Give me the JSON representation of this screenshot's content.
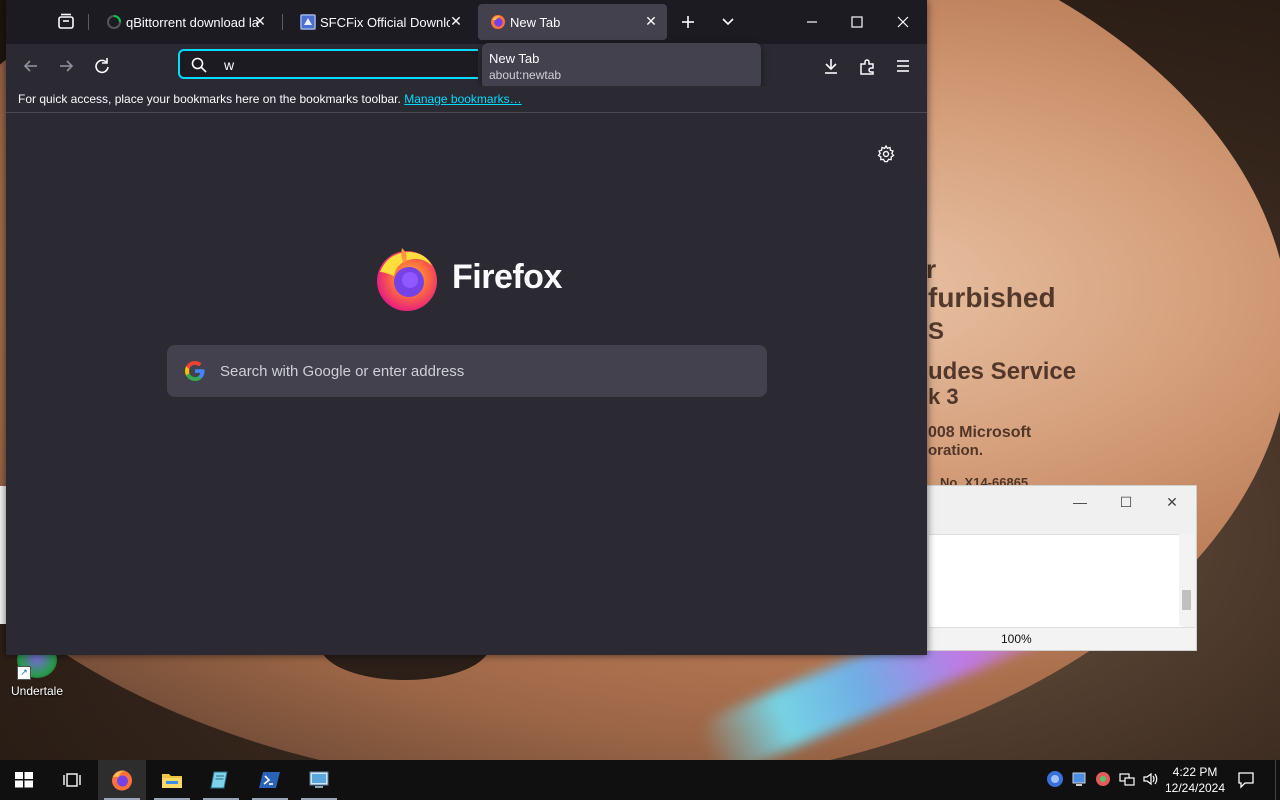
{
  "browser": {
    "tabs": [
      {
        "title": "qBittorrent download lat",
        "active": false
      },
      {
        "title": "SFCFix Official Download",
        "active": false
      },
      {
        "title": "New Tab",
        "active": true
      }
    ],
    "urlbar": {
      "value": "w"
    },
    "tab_tooltip": {
      "title": "New Tab",
      "url": "about:newtab"
    },
    "bookmarks_bar": {
      "message": "For quick access, place your bookmarks here on the bookmarks toolbar.",
      "link": "Manage bookmarks…"
    },
    "newtab": {
      "brand": "Firefox",
      "search_placeholder": "Search with Google or enter address"
    }
  },
  "background_window": {
    "zoom": "100%"
  },
  "desktop": {
    "icons": [
      {
        "label": "Undertale"
      }
    ],
    "wallpaper_text": [
      "r",
      "furbished",
      "S",
      "udes Service",
      "k 3",
      "008 Microsoft",
      "oration.",
      "No. X14-66865"
    ]
  },
  "taskbar": {
    "apps": [
      "start",
      "task-view",
      "firefox",
      "file-explorer",
      "notepad",
      "powershell",
      "control-panel"
    ],
    "clock": {
      "time": "4:22 PM",
      "date": "12/24/2024"
    }
  },
  "colors": {
    "accent": "#00ddff",
    "toolbar_bg": "#2b2a33",
    "tabbar_bg": "#1c1b22",
    "active_tab_bg": "#42414d"
  }
}
